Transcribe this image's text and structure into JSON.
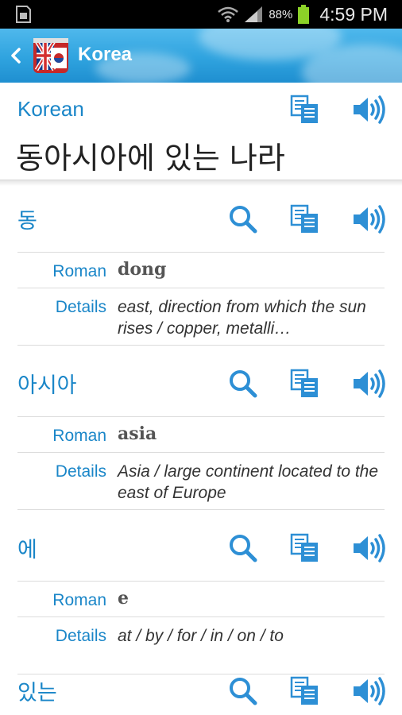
{
  "status_bar": {
    "battery_percent": "88%",
    "time": "4:59 PM"
  },
  "action_bar": {
    "title": "Korea"
  },
  "header": {
    "language": "Korean",
    "phrase": "동아시아에 있는 나라"
  },
  "colors": {
    "accent": "#1a86c8",
    "icon": "#2d8fd5",
    "actionbar": "#2fa3df"
  },
  "words": [
    {
      "word": "동",
      "roman_label": "Roman",
      "roman": "dong",
      "details_label": "Details",
      "details": "east, direction from which the sun rises / copper, metalli…"
    },
    {
      "word": "아시아",
      "roman_label": "Roman",
      "roman": "asia",
      "details_label": "Details",
      "details": "Asia / large continent located to the east of Europe"
    },
    {
      "word": "에",
      "roman_label": "Roman",
      "roman": "e",
      "details_label": "Details",
      "details": "at / by / for / in / on / to"
    },
    {
      "word": "있는"
    }
  ],
  "icons": [
    "back-icon",
    "app-icon",
    "copy-icon",
    "speaker-icon",
    "search-icon"
  ]
}
